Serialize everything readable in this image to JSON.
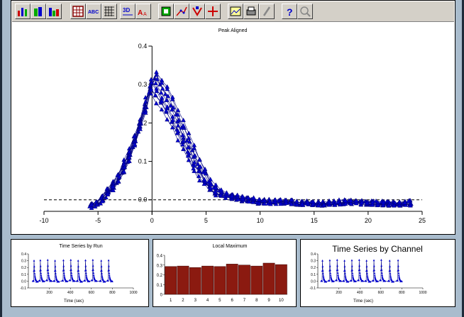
{
  "toolbar": {
    "buttons": [
      {
        "name": "bar-chart-icon"
      },
      {
        "name": "3d-bar-icon"
      },
      {
        "name": "stacked-bar-icon"
      },
      {
        "name": "data-grid-icon"
      },
      {
        "name": "abc-text-icon",
        "label": "ABC"
      },
      {
        "name": "table-grid-icon"
      },
      {
        "name": "3d-rotate-icon",
        "label": "3D"
      },
      {
        "name": "font-size-icon",
        "label": "A"
      },
      {
        "name": "border-icon"
      },
      {
        "name": "scatter-icon"
      },
      {
        "name": "marker-icon"
      },
      {
        "name": "crosshair-icon"
      },
      {
        "name": "image-icon"
      },
      {
        "name": "print-icon"
      },
      {
        "name": "pen-icon"
      },
      {
        "name": "help-icon",
        "label": "?"
      },
      {
        "name": "zoom-icon"
      }
    ]
  },
  "main_chart": {
    "chart_data": {
      "type": "scatter",
      "title": "Peak Aligned",
      "xlabel": "",
      "ylabel": "",
      "xlim": [
        -10,
        25
      ],
      "ylim": [
        -0.03,
        0.4
      ],
      "xticks": [
        "-10",
        "-5",
        "0",
        "5",
        "10",
        "15",
        "20",
        "25"
      ],
      "yticks": [
        "0.0",
        "0.1",
        "0.2",
        "0.3",
        "0.4"
      ],
      "baseline": 0,
      "marker": "triangle",
      "color": "#0000cc",
      "series_count": 10,
      "x": [
        -5.8,
        -5,
        -4,
        -3,
        -2,
        -1,
        -0.5,
        0,
        0.5,
        1,
        2,
        3,
        4,
        5,
        6,
        7,
        8,
        9,
        10,
        12,
        14,
        16,
        18,
        20,
        22,
        24
      ],
      "values": [
        -0.015,
        -0.01,
        0.02,
        0.06,
        0.12,
        0.2,
        0.25,
        0.31,
        0.29,
        0.27,
        0.22,
        0.16,
        0.1,
        0.05,
        0.02,
        0.01,
        0.005,
        0.0,
        -0.005,
        -0.005,
        -0.008,
        -0.01,
        -0.005,
        -0.008,
        -0.01,
        -0.008
      ]
    }
  },
  "panels": {
    "run": {
      "title": "Time Series by Run",
      "xlabel": "Time (sec)",
      "xticks": [
        "200",
        "400",
        "600",
        "800",
        "1000"
      ],
      "yticks": [
        "-0.1",
        "0.0",
        "0.1",
        "0.2",
        "0.3",
        "0.4"
      ],
      "xlim": [
        0,
        1000
      ],
      "ylim": [
        -0.1,
        0.4
      ],
      "peaks_at": [
        50,
        110,
        180,
        250,
        330,
        400,
        470,
        540,
        610,
        690,
        760
      ]
    },
    "local_max": {
      "chart_data": {
        "type": "bar",
        "title": "Local Maximum",
        "categories": [
          "1",
          "2",
          "3",
          "4",
          "5",
          "6",
          "7",
          "8",
          "9",
          "10"
        ],
        "values": [
          0.285,
          0.29,
          0.275,
          0.29,
          0.285,
          0.31,
          0.3,
          0.29,
          0.32,
          0.305
        ],
        "ylim": [
          0,
          0.4
        ],
        "yticks": [
          "0",
          "0.1",
          "0.2",
          "0.3",
          "0.4"
        ],
        "color": "#8b1a10"
      }
    },
    "channel": {
      "title": "Time Series by Channel",
      "xlabel": "Time (sec)",
      "xticks": [
        "200",
        "400",
        "600",
        "800",
        "1000"
      ],
      "yticks": [
        "-0.1",
        "0.0",
        "0.1",
        "0.2",
        "0.3",
        "0.4"
      ],
      "xlim": [
        0,
        1000
      ],
      "ylim": [
        -0.1,
        0.4
      ],
      "peaks_at": [
        40,
        110,
        180,
        250,
        320,
        390,
        460,
        530,
        600,
        680,
        760
      ]
    }
  }
}
